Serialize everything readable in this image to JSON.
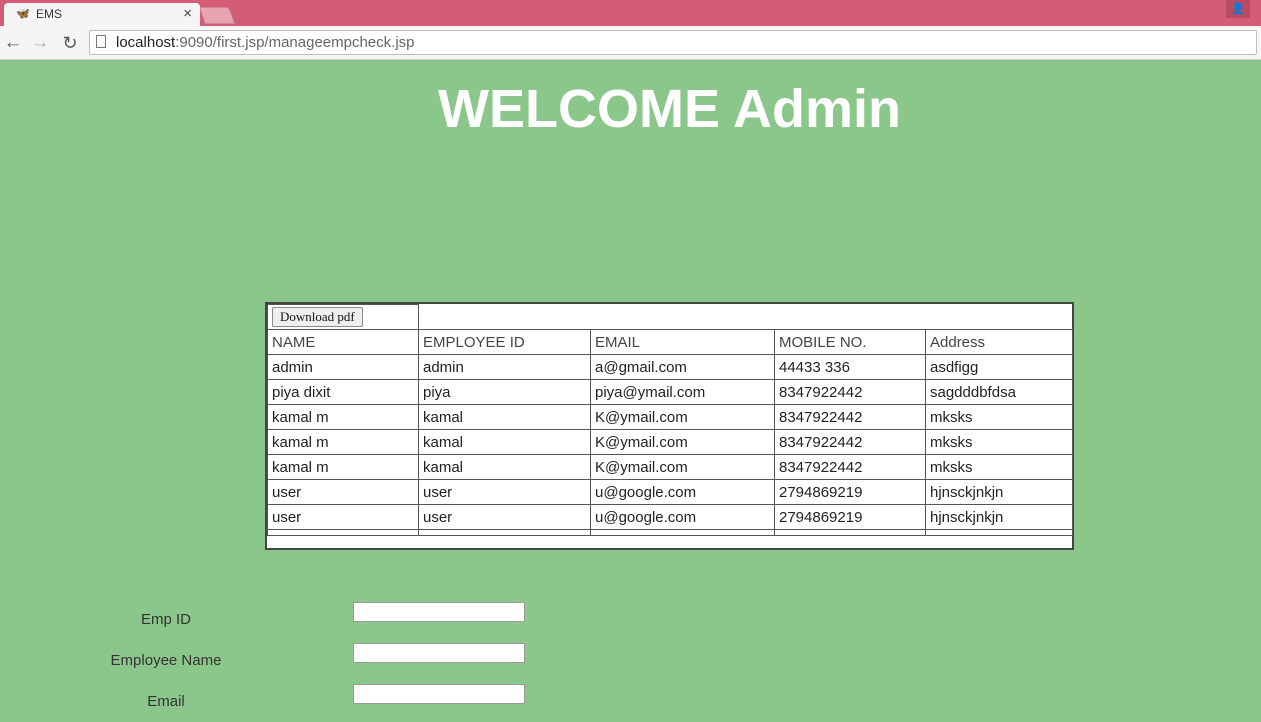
{
  "browser": {
    "tab_title": "EMS",
    "tab_close": "×",
    "favicon": "🦋",
    "profile": "👤",
    "url_host": "localhost",
    "url_path": ":9090/first.jsp/manageempcheck.jsp",
    "back": "←",
    "forward": "→",
    "reload": "↻"
  },
  "page": {
    "title": "WELCOME Admin"
  },
  "table": {
    "download_label": "Download pdf",
    "columns": [
      "NAME",
      "EMPLOYEE ID",
      "EMAIL",
      "MOBILE NO.",
      "Address"
    ],
    "rows": [
      [
        "admin",
        "admin",
        "a@gmail.com",
        "44433 336",
        "asdfigg"
      ],
      [
        "piya dixit",
        "piya",
        "piya@ymail.com",
        "8347922442",
        "sagdddbfdsa"
      ],
      [
        "kamal m",
        "kamal",
        "K@ymail.com",
        "8347922442",
        "mksks"
      ],
      [
        "kamal m",
        "kamal",
        "K@ymail.com",
        "8347922442",
        "mksks"
      ],
      [
        "kamal m",
        "kamal",
        "K@ymail.com",
        "8347922442",
        "mksks"
      ],
      [
        "user",
        "user",
        "u@google.com",
        "2794869219",
        "hjnsckjnkjn"
      ],
      [
        "user",
        "user",
        "u@google.com",
        "2794869219",
        "hjnsckjnkjn"
      ]
    ]
  },
  "form": {
    "emp_id_label": "Emp ID",
    "emp_id_value": "",
    "employee_name_label": "Employee Name",
    "employee_name_value": "",
    "email_label": "Email",
    "email_value": ""
  }
}
